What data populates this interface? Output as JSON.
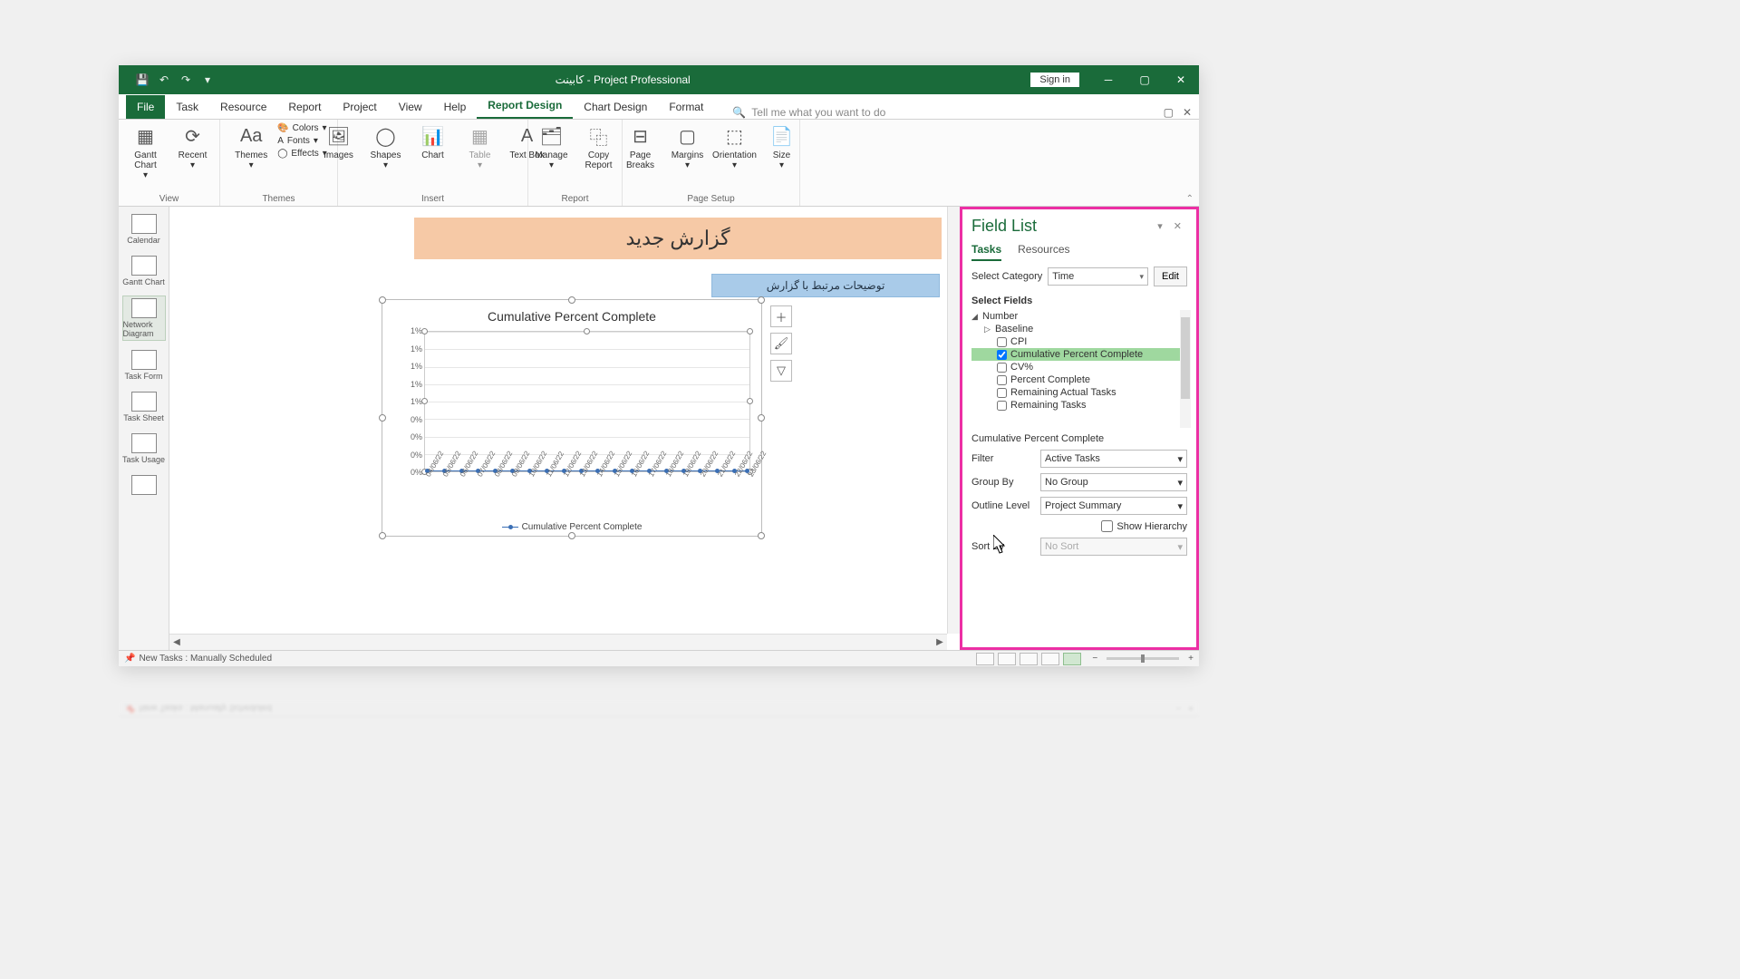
{
  "window": {
    "title": "کابینت - Project Professional",
    "signin": "Sign in"
  },
  "tabs": {
    "file": "File",
    "task": "Task",
    "resource": "Resource",
    "report": "Report",
    "project": "Project",
    "view": "View",
    "help": "Help",
    "report_design": "Report Design",
    "chart_design": "Chart Design",
    "format": "Format",
    "tell_me": "Tell me what you want to do"
  },
  "ribbon": {
    "view_group": "View",
    "gantt_chart": "Gantt Chart",
    "recent": "Recent",
    "themes_group": "Themes",
    "themes": "Themes",
    "colors": "Colors",
    "fonts": "Fonts",
    "effects": "Effects",
    "insert_group": "Insert",
    "images": "Images",
    "shapes": "Shapes",
    "chart": "Chart",
    "table": "Table",
    "text_box": "Text Box",
    "report_group": "Report",
    "manage": "Manage",
    "copy_report": "Copy Report",
    "page_setup_group": "Page Setup",
    "page_breaks": "Page Breaks",
    "margins": "Margins",
    "orientation": "Orientation",
    "size": "Size"
  },
  "sidebar": {
    "calendar": "Calendar",
    "gantt_chart": "Gantt Chart",
    "network_diagram": "Network Diagram",
    "task_form": "Task Form",
    "task_sheet": "Task Sheet",
    "task_usage": "Task Usage"
  },
  "report": {
    "title": "گزارش جدید",
    "subtitle": "توضیحات مرتبط با گزارش",
    "chart_title": "Cumulative Percent Complete",
    "legend": "Cumulative Percent Complete"
  },
  "chart_data": {
    "type": "line",
    "title": "Cumulative Percent Complete",
    "ylabel": "",
    "xlabel": "",
    "ylim": [
      0,
      0.01
    ],
    "y_tick_labels": [
      "1%",
      "1%",
      "1%",
      "1%",
      "1%",
      "0%",
      "0%",
      "0%",
      "0%"
    ],
    "categories": [
      "04/06/22",
      "05/06/22",
      "06/06/22",
      "07/06/22",
      "08/06/22",
      "09/06/22",
      "10/06/22",
      "11/06/22",
      "12/06/22",
      "13/06/22",
      "14/06/22",
      "15/06/22",
      "16/06/22",
      "17/06/22",
      "18/06/22",
      "19/06/22",
      "20/06/22",
      "21/06/22",
      "22/06/22",
      "23/06/22"
    ],
    "series": [
      {
        "name": "Cumulative Percent Complete",
        "values": [
          0,
          0,
          0,
          0,
          0,
          0,
          0,
          0,
          0,
          0,
          0,
          0,
          0,
          0,
          0,
          0,
          0,
          0,
          0,
          0
        ]
      }
    ]
  },
  "fieldlist": {
    "title": "Field List",
    "tab_tasks": "Tasks",
    "tab_resources": "Resources",
    "select_category_label": "Select Category",
    "select_category_value": "Time",
    "edit": "Edit",
    "select_fields": "Select Fields",
    "group_number": "Number",
    "group_baseline": "Baseline",
    "f_cpi": "CPI",
    "f_cpc": "Cumulative Percent Complete",
    "f_cv": "CV%",
    "f_pc": "Percent Complete",
    "f_rat": "Remaining Actual Tasks",
    "f_rt": "Remaining Tasks",
    "selected_field": "Cumulative Percent Complete",
    "filter_label": "Filter",
    "filter_value": "Active Tasks",
    "groupby_label": "Group By",
    "groupby_value": "No Group",
    "outline_label": "Outline Level",
    "outline_value": "Project Summary",
    "show_hierarchy": "Show Hierarchy",
    "sortby_label": "Sort By",
    "sortby_value": "No Sort"
  },
  "statusbar": {
    "new_tasks": "New Tasks : Manually Scheduled"
  }
}
